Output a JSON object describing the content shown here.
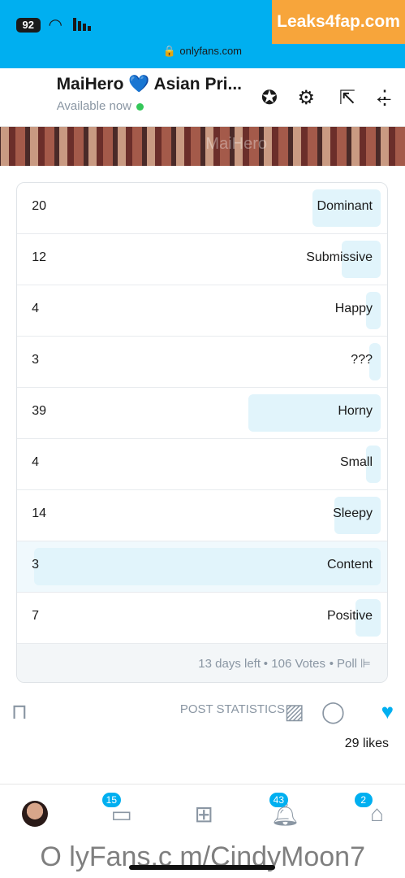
{
  "status_bar": {
    "time": "92",
    "url": "onlyfans.com"
  },
  "watermark": "Leaks4fap.com",
  "header": {
    "title": "MaiHero 💙 Asian Pri...",
    "availability": "Available now"
  },
  "banner_overlay": "MaiHero",
  "poll": {
    "options": [
      {
        "label": "Dominant",
        "votes": "20",
        "share": 0.19
      },
      {
        "label": "Submissive",
        "votes": "12",
        "share": 0.11
      },
      {
        "label": "Happy",
        "votes": "4",
        "share": 0.04
      },
      {
        "label": "???",
        "votes": "3",
        "share": 0.03
      },
      {
        "label": "Horny",
        "votes": "39",
        "share": 0.37
      },
      {
        "label": "Small",
        "votes": "4",
        "share": 0.04
      },
      {
        "label": "Sleepy",
        "votes": "14",
        "share": 0.13
      },
      {
        "label": "Content",
        "votes": "3",
        "share": 0.97,
        "selected": true
      },
      {
        "label": "Positive",
        "votes": "7",
        "share": 0.07
      }
    ],
    "type": "Poll",
    "votes_text": "106 Votes",
    "time_left": "13 days left"
  },
  "actions": {
    "stats_label": "POST STATISTICS"
  },
  "likes": "29 likes",
  "tabbar": {
    "home_badge": "2",
    "notifications_badge": "43",
    "messages_badge": "15"
  },
  "bottom_watermark": "O lyFans.c m/CindyMoon7",
  "colors": {
    "brand": "#00aff0",
    "fill": "#e1f4fb",
    "muted": "#8a96a3"
  }
}
